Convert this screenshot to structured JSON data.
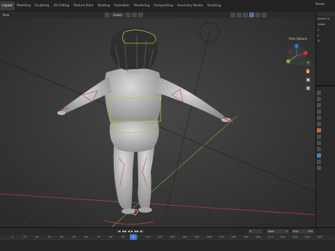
{
  "header": {
    "tabs": [
      "Layout",
      "Modeling",
      "Sculpting",
      "UV Editing",
      "Texture Paint",
      "Shading",
      "Animation",
      "Rendering",
      "Compositing",
      "Geometry Nodes",
      "Scripting"
    ],
    "active_tab": "Layout",
    "scene_label": "Scene"
  },
  "viewport_header": {
    "mode": "Pose",
    "transform_orientation": "Global",
    "pose_options": "Pose Options"
  },
  "timeline": {
    "ruler_ticks": [
      "0",
      "10",
      "20",
      "30",
      "40",
      "50",
      "60",
      "70",
      "80",
      "90",
      "100",
      "110",
      "120",
      "130",
      "140",
      "150",
      "160",
      "170",
      "180",
      "190",
      "200",
      "210",
      "220",
      "230",
      "240",
      "250"
    ],
    "current_frame": "0",
    "start_label": "Start",
    "start_value": "1",
    "end_label": "End",
    "end_value": "250",
    "playback": [
      "|◀",
      "◀◀",
      "◀",
      "▶",
      "▶▶",
      "▶|"
    ]
  },
  "outliner": {
    "rows": [
      "Scene Co",
      "Collec",
      "C",
      "L",
      "G"
    ]
  },
  "colors": {
    "accent": "#4a7ad0",
    "x_axis": "#c23a3a",
    "y_axis": "#7aa83a",
    "bone_outline": "#c8b83a"
  },
  "icons": [
    "eye-icon",
    "camera-icon",
    "hand-icon",
    "grid-icon",
    "search-icon",
    "gear-icon"
  ]
}
